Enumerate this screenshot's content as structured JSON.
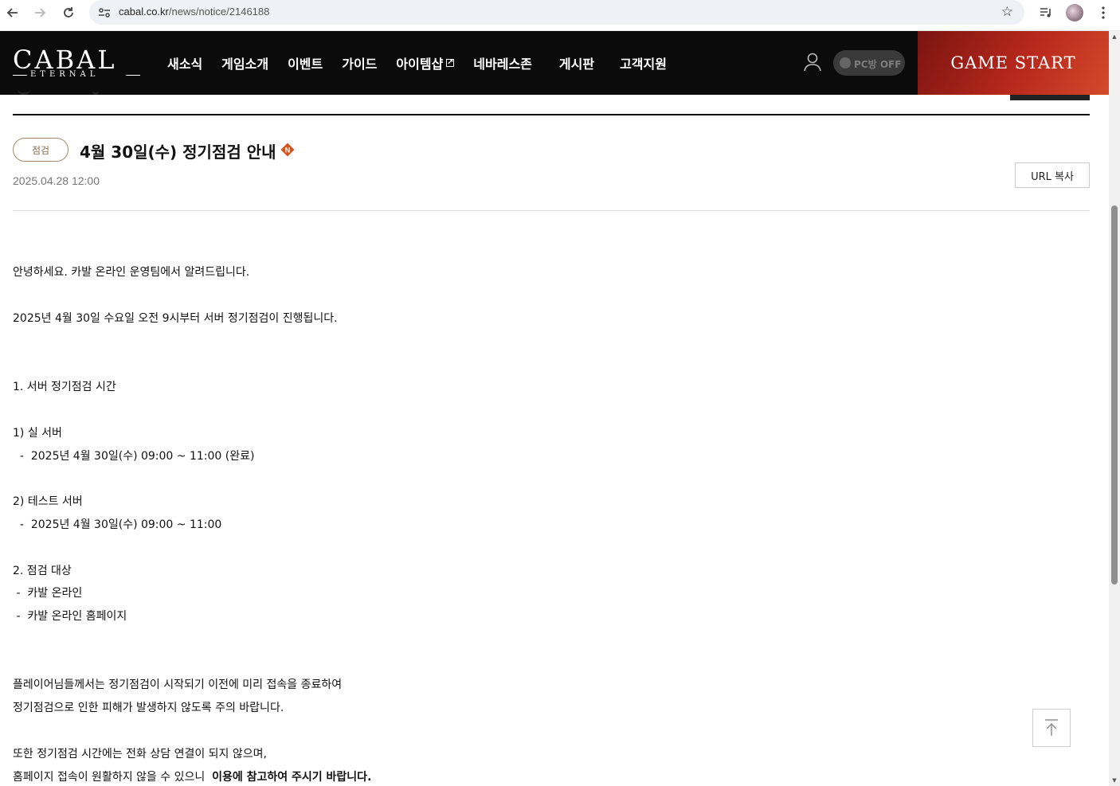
{
  "browser": {
    "back_icon": "arrow-left-icon",
    "forward_icon": "arrow-right-icon",
    "reload_icon": "reload-icon",
    "url_host": "cabal.co.kr",
    "url_path": "/news/notice/2146188"
  },
  "header": {
    "logo_main": "CABAL",
    "logo_sub": "ETERNAL",
    "menu": [
      {
        "label": "새소식"
      },
      {
        "label": "게임소개"
      },
      {
        "label": "이벤트"
      },
      {
        "label": "가이드"
      },
      {
        "label": "아이템샵"
      },
      {
        "label": "네바레스존"
      },
      {
        "label": "게시판"
      },
      {
        "label": "고객지원"
      }
    ],
    "pc_toggle_prefix": "PC방",
    "pc_toggle_state": "OFF",
    "game_start": "GAME START"
  },
  "article": {
    "category": "점검",
    "title": "4월 30일(수) 정기점검 안내",
    "new_badge": "N",
    "date": "2025.04.28 12:00",
    "url_copy": "URL 복사",
    "lines": {
      "l1": "안녕하세요. 카발 온라인 운영팀에서 알려드립니다.",
      "l2": "2025년 4월 30일 수요일 오전 9시부터 서버 정기점검이 진행됩니다.",
      "l3": "1. 서버 정기점검 시간",
      "l4": "1) 실 서버",
      "l5": "  -  2025년 4월 30일(수) 09:00 ~ 11:00 (완료)",
      "l6": "2) 테스트 서버",
      "l7": "  -  2025년 4월 30일(수) 09:00 ~ 11:00",
      "l8": "2. 점검 대상",
      "l9": " -  카발 온라인",
      "l10": " -  카발 온라인 홈페이지",
      "l11": "플레이어님들께서는 정기점검이 시작되기 이전에 미리 접속을 종료하여",
      "l12": "정기점검으로 인한 피해가 발생하지 않도록 주의 바랍니다.",
      "l13": "또한 정기점검 시간에는 전화 상담 연결이 되지 않으며,",
      "l14a": "홈페이지 접속이 원활하지 않을 수 있으니  ",
      "l14b": "이용에 참고하여 주시기 바랍니다."
    }
  },
  "colors": {
    "header_bg": "#0b0b0b",
    "game_start_bg": "#b8281c",
    "badge_border": "#a68a6a",
    "new_icon": "#d4541c"
  }
}
